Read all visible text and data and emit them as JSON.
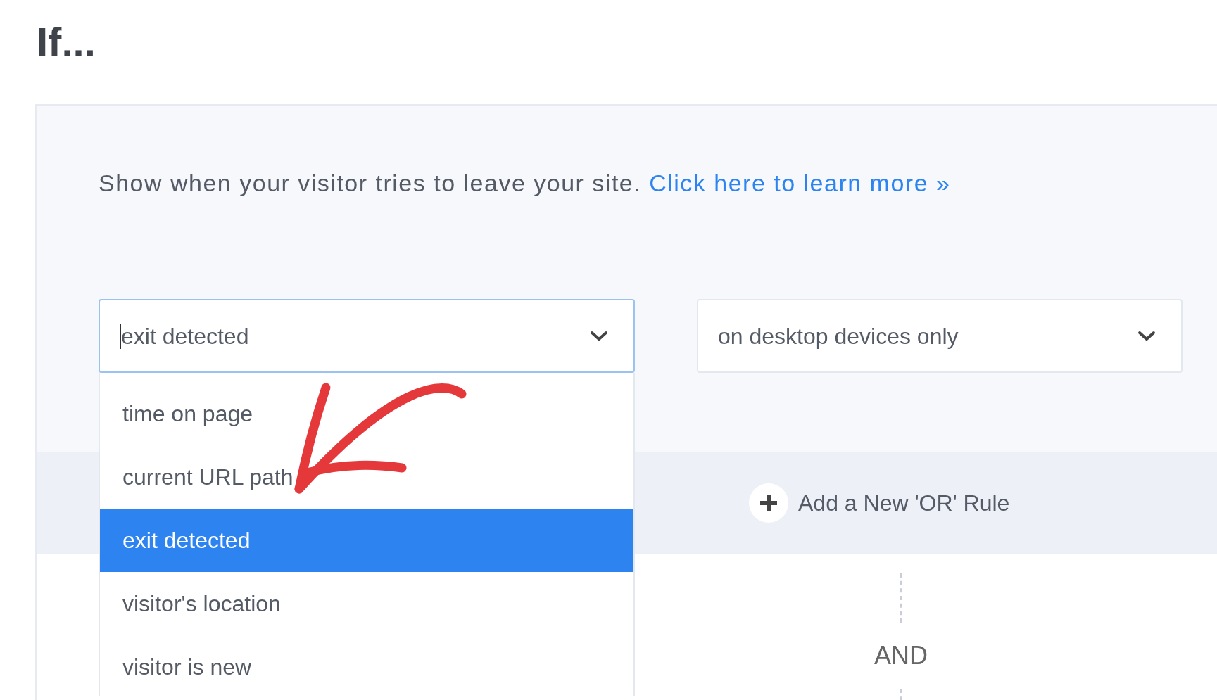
{
  "heading": "If...",
  "description": {
    "text": "Show when your visitor tries to leave your site.",
    "link": "Click here to learn more »"
  },
  "condition_select": {
    "value": "exit detected",
    "expanded": true,
    "options": [
      {
        "label": "time on page",
        "selected": false
      },
      {
        "label": "current URL path",
        "selected": false
      },
      {
        "label": "exit detected",
        "selected": true
      },
      {
        "label": "visitor's location",
        "selected": false
      },
      {
        "label": "visitor is new",
        "selected": false
      }
    ]
  },
  "device_select": {
    "value": "on desktop devices only"
  },
  "add_or_rule_button": {
    "label": "Add a New 'OR' Rule"
  },
  "connector": "AND"
}
